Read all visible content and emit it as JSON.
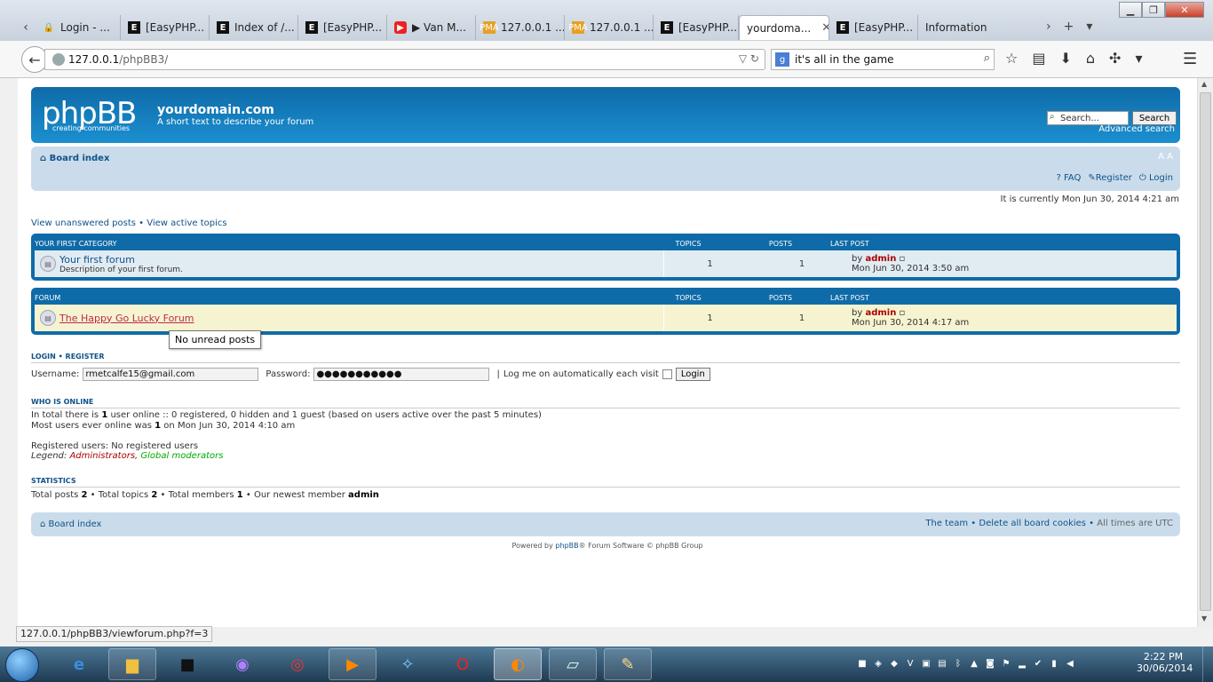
{
  "browser": {
    "tabs": [
      {
        "label": "Login - ...",
        "icon": "lock-icon"
      },
      {
        "label": "[EasyPHP...",
        "icon": "easyphp-icon"
      },
      {
        "label": "Index of /...",
        "icon": "easyphp-icon"
      },
      {
        "label": "[EasyPHP...",
        "icon": "easyphp-icon"
      },
      {
        "label": "▶ Van M...",
        "icon": "youtube-icon"
      },
      {
        "label": "127.0.0.1 ...",
        "icon": "phpmyadmin-icon"
      },
      {
        "label": "127.0.0.1 ...",
        "icon": "phpmyadmin-icon"
      },
      {
        "label": "[EasyPHP...",
        "icon": "easyphp-icon"
      },
      {
        "label": "yourdoma...",
        "icon": "none",
        "active": true
      },
      {
        "label": "[EasyPHP...",
        "icon": "easyphp-icon"
      },
      {
        "label": "Information",
        "icon": "none"
      }
    ],
    "url_host": "127.0.0.1",
    "url_path": "/phpBB3/",
    "search_value": "it's all in the game",
    "status_url": "127.0.0.1/phpBB3/viewforum.php?f=3"
  },
  "forum": {
    "logo": "phpBB",
    "logo_sub": "creating   communities",
    "site_title": "yourdomain.com",
    "site_desc": "A short text to describe your forum",
    "search_placeholder": "Search...",
    "search_button": "Search",
    "advanced_search": "Advanced search",
    "board_index": "Board index",
    "font_size": "A A",
    "faq": "FAQ",
    "register": "Register",
    "login": "Login",
    "current_time": "It is currently Mon Jun 30, 2014 4:21 am",
    "view_unanswered": "View unanswered posts",
    "view_active": "View active topics",
    "header_topics": "TOPICS",
    "header_posts": "POSTS",
    "header_lastpost": "LAST POST",
    "categories": [
      {
        "name": "YOUR FIRST CATEGORY",
        "forum_name": "Your first forum",
        "forum_desc": "Description of your first forum.",
        "topics": "1",
        "posts": "1",
        "last_by": "by",
        "last_user": "admin",
        "last_date": "Mon Jun 30, 2014 3:50 am"
      },
      {
        "name": "FORUM",
        "forum_name": "The Happy Go Lucky Forum",
        "forum_desc": "",
        "topics": "1",
        "posts": "1",
        "last_by": "by",
        "last_user": "admin",
        "last_date": "Mon Jun 30, 2014 4:17 am"
      }
    ],
    "tooltip": "No unread posts",
    "login_heading": "LOGIN",
    "register_heading": "REGISTER",
    "username_label": "Username:",
    "username_value": "rmetcalfe15@gmail.com",
    "password_label": "Password:",
    "password_value": "●●●●●●●●●●●",
    "auto_login_label": "Log me on automatically each visit",
    "login_button": "Login",
    "who_online_heading": "WHO IS ONLINE",
    "online_line1_a": "In total there is ",
    "online_line1_count": "1",
    "online_line1_b": " user online :: 0 registered, 0 hidden and 1 guest (based on users active over the past 5 minutes)",
    "online_line2_a": "Most users ever online was ",
    "online_line2_count": "1",
    "online_line2_b": " on Mon Jun 30, 2014 4:10 am",
    "registered_users": "Registered users: No registered users",
    "legend_label": "Legend:",
    "legend_admins": "Administrators",
    "legend_mods": "Global moderators",
    "stats_heading": "STATISTICS",
    "stats_a": "Total posts ",
    "stats_posts": "2",
    "stats_b": " • Total topics ",
    "stats_topics": "2",
    "stats_c": " • Total members ",
    "stats_members": "1",
    "stats_d": " • Our newest member ",
    "stats_newest": "admin",
    "footer_team": "The team",
    "footer_delete": "Delete all board cookies",
    "footer_tz": "All times are UTC",
    "powered_a": "Powered by ",
    "powered_link": "phpBB",
    "powered_b": "® Forum Software © phpBB Group"
  },
  "taskbar": {
    "time": "2:22 PM",
    "date": "30/06/2014"
  },
  "colors": {
    "header_blue": "#0f6ba8",
    "nav_light": "#cadceb",
    "link": "#105289",
    "admin_red": "#aa0000"
  }
}
